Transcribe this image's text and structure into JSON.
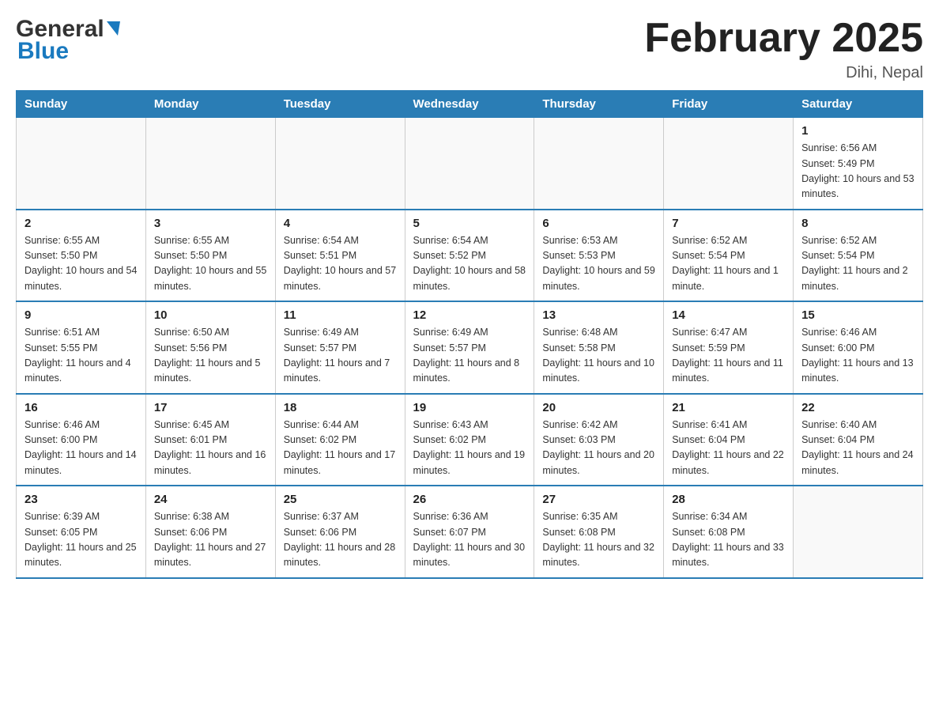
{
  "header": {
    "logo_general": "General",
    "logo_blue": "Blue",
    "title": "February 2025",
    "location": "Dihi, Nepal"
  },
  "days_of_week": [
    "Sunday",
    "Monday",
    "Tuesday",
    "Wednesday",
    "Thursday",
    "Friday",
    "Saturday"
  ],
  "weeks": [
    [
      {
        "day": "",
        "info": ""
      },
      {
        "day": "",
        "info": ""
      },
      {
        "day": "",
        "info": ""
      },
      {
        "day": "",
        "info": ""
      },
      {
        "day": "",
        "info": ""
      },
      {
        "day": "",
        "info": ""
      },
      {
        "day": "1",
        "info": "Sunrise: 6:56 AM\nSunset: 5:49 PM\nDaylight: 10 hours and 53 minutes."
      }
    ],
    [
      {
        "day": "2",
        "info": "Sunrise: 6:55 AM\nSunset: 5:50 PM\nDaylight: 10 hours and 54 minutes."
      },
      {
        "day": "3",
        "info": "Sunrise: 6:55 AM\nSunset: 5:50 PM\nDaylight: 10 hours and 55 minutes."
      },
      {
        "day": "4",
        "info": "Sunrise: 6:54 AM\nSunset: 5:51 PM\nDaylight: 10 hours and 57 minutes."
      },
      {
        "day": "5",
        "info": "Sunrise: 6:54 AM\nSunset: 5:52 PM\nDaylight: 10 hours and 58 minutes."
      },
      {
        "day": "6",
        "info": "Sunrise: 6:53 AM\nSunset: 5:53 PM\nDaylight: 10 hours and 59 minutes."
      },
      {
        "day": "7",
        "info": "Sunrise: 6:52 AM\nSunset: 5:54 PM\nDaylight: 11 hours and 1 minute."
      },
      {
        "day": "8",
        "info": "Sunrise: 6:52 AM\nSunset: 5:54 PM\nDaylight: 11 hours and 2 minutes."
      }
    ],
    [
      {
        "day": "9",
        "info": "Sunrise: 6:51 AM\nSunset: 5:55 PM\nDaylight: 11 hours and 4 minutes."
      },
      {
        "day": "10",
        "info": "Sunrise: 6:50 AM\nSunset: 5:56 PM\nDaylight: 11 hours and 5 minutes."
      },
      {
        "day": "11",
        "info": "Sunrise: 6:49 AM\nSunset: 5:57 PM\nDaylight: 11 hours and 7 minutes."
      },
      {
        "day": "12",
        "info": "Sunrise: 6:49 AM\nSunset: 5:57 PM\nDaylight: 11 hours and 8 minutes."
      },
      {
        "day": "13",
        "info": "Sunrise: 6:48 AM\nSunset: 5:58 PM\nDaylight: 11 hours and 10 minutes."
      },
      {
        "day": "14",
        "info": "Sunrise: 6:47 AM\nSunset: 5:59 PM\nDaylight: 11 hours and 11 minutes."
      },
      {
        "day": "15",
        "info": "Sunrise: 6:46 AM\nSunset: 6:00 PM\nDaylight: 11 hours and 13 minutes."
      }
    ],
    [
      {
        "day": "16",
        "info": "Sunrise: 6:46 AM\nSunset: 6:00 PM\nDaylight: 11 hours and 14 minutes."
      },
      {
        "day": "17",
        "info": "Sunrise: 6:45 AM\nSunset: 6:01 PM\nDaylight: 11 hours and 16 minutes."
      },
      {
        "day": "18",
        "info": "Sunrise: 6:44 AM\nSunset: 6:02 PM\nDaylight: 11 hours and 17 minutes."
      },
      {
        "day": "19",
        "info": "Sunrise: 6:43 AM\nSunset: 6:02 PM\nDaylight: 11 hours and 19 minutes."
      },
      {
        "day": "20",
        "info": "Sunrise: 6:42 AM\nSunset: 6:03 PM\nDaylight: 11 hours and 20 minutes."
      },
      {
        "day": "21",
        "info": "Sunrise: 6:41 AM\nSunset: 6:04 PM\nDaylight: 11 hours and 22 minutes."
      },
      {
        "day": "22",
        "info": "Sunrise: 6:40 AM\nSunset: 6:04 PM\nDaylight: 11 hours and 24 minutes."
      }
    ],
    [
      {
        "day": "23",
        "info": "Sunrise: 6:39 AM\nSunset: 6:05 PM\nDaylight: 11 hours and 25 minutes."
      },
      {
        "day": "24",
        "info": "Sunrise: 6:38 AM\nSunset: 6:06 PM\nDaylight: 11 hours and 27 minutes."
      },
      {
        "day": "25",
        "info": "Sunrise: 6:37 AM\nSunset: 6:06 PM\nDaylight: 11 hours and 28 minutes."
      },
      {
        "day": "26",
        "info": "Sunrise: 6:36 AM\nSunset: 6:07 PM\nDaylight: 11 hours and 30 minutes."
      },
      {
        "day": "27",
        "info": "Sunrise: 6:35 AM\nSunset: 6:08 PM\nDaylight: 11 hours and 32 minutes."
      },
      {
        "day": "28",
        "info": "Sunrise: 6:34 AM\nSunset: 6:08 PM\nDaylight: 11 hours and 33 minutes."
      },
      {
        "day": "",
        "info": ""
      }
    ]
  ]
}
